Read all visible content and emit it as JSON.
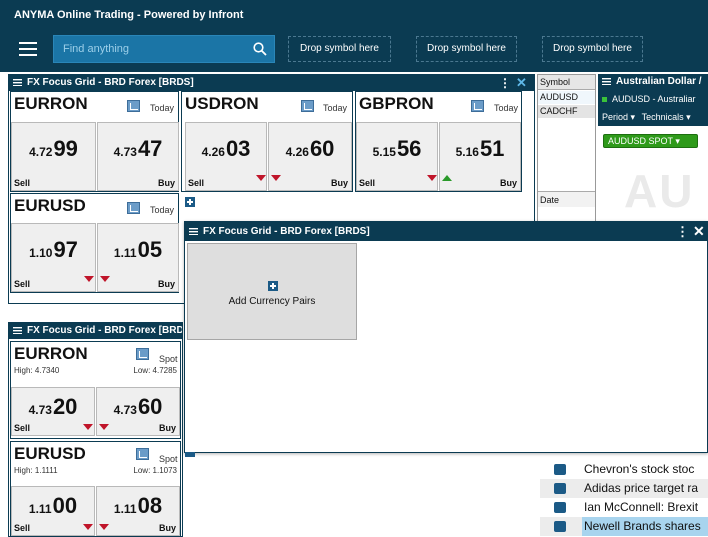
{
  "app": {
    "title": "ANYMA Online Trading - Powered by Infront"
  },
  "toolbar": {
    "search_placeholder": "Find anything",
    "drop_slots": [
      "Drop symbol here",
      "Drop symbol here",
      "Drop symbol here"
    ]
  },
  "grid_top": {
    "title": "FX Focus Grid - BRD Forex [BRDS]",
    "tiles": [
      {
        "name": "EURRON",
        "mode": "Today",
        "sell_prefix": "4.72",
        "sell_big": "99",
        "buy_prefix": "4.73",
        "buy_big": "47",
        "sell_label": "Sell",
        "buy_label": "Buy"
      },
      {
        "name": "USDRON",
        "mode": "Today",
        "sell_prefix": "4.26",
        "sell_big": "03",
        "buy_prefix": "4.26",
        "buy_big": "60",
        "sell_label": "Sell",
        "buy_label": "Buy"
      },
      {
        "name": "GBPRON",
        "mode": "Today",
        "sell_prefix": "5.15",
        "sell_big": "56",
        "buy_prefix": "5.16",
        "buy_big": "51",
        "sell_label": "Sell",
        "buy_label": "Buy"
      },
      {
        "name": "EURUSD",
        "mode": "Today",
        "sell_prefix": "1.10",
        "sell_big": "97",
        "buy_prefix": "1.11",
        "buy_big": "05",
        "sell_label": "Sell",
        "buy_label": "Buy"
      }
    ]
  },
  "grid_bottom": {
    "title": "FX Focus Grid - BRD Forex [BRD",
    "tiles": [
      {
        "name": "EURRON",
        "mode": "Spot",
        "high": "High: 4.7340",
        "low": "Low: 4.7285",
        "sell_prefix": "4.73",
        "sell_big": "20",
        "buy_prefix": "4.73",
        "buy_big": "60",
        "sell_label": "Sell",
        "buy_label": "Buy"
      },
      {
        "name": "EURUSD",
        "mode": "Spot",
        "high": "High: 1.1111",
        "low": "Low: 1.1073",
        "sell_prefix": "1.11",
        "sell_big": "00",
        "buy_prefix": "1.11",
        "buy_big": "08",
        "sell_label": "Sell",
        "buy_label": "Buy"
      }
    ]
  },
  "symbols": {
    "header": "Symbol",
    "items": [
      "AUDUSD",
      "CADCHF"
    ],
    "date_label": "Date"
  },
  "aud_panel": {
    "title": "Australian Dollar /",
    "subtitle": "AUDUSD - Australiar",
    "menu": [
      "Period",
      "Technicals"
    ],
    "spot_button": "AUDUSD SPOT",
    "watermark": "AU"
  },
  "overlay": {
    "title": "FX Focus Grid - BRD Forex [BRDS]",
    "add_label": "Add Currency Pairs"
  },
  "news": [
    "Chevron's stock stoc",
    "Adidas price target ra",
    "Ian McConnell: Brexit",
    "Newell Brands shares"
  ],
  "colors": {
    "header": "#0b3b52",
    "search": "#1b75a6",
    "down": "#c0152a",
    "up": "#2a9a2a",
    "spot_btn": "#2e9a1a",
    "news_highlight": "#a8d4ee"
  }
}
